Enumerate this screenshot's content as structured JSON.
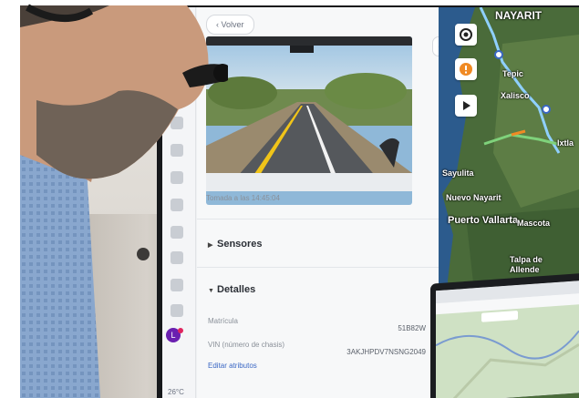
{
  "app": {
    "back_label": "Volver",
    "dashcam": {
      "caption": "Tomada a las 14:45:04"
    },
    "sections": {
      "sensores": "Sensores",
      "detalles": "Detalles"
    },
    "details": {
      "matricula_label": "Matrícula",
      "matricula_value": "51B82W",
      "vin_label": "VIN (número de chasis)",
      "vin_value": "3AKJHPDV7NSNG2049",
      "edit_link": "Editar atributos"
    },
    "rail": {
      "avatar_initial": "L",
      "temperature": "26°C"
    }
  },
  "map": {
    "labels": {
      "nayarit": "NAYARIT",
      "tepic": "Tepic",
      "xalisco": "Xalisco",
      "ixtlan": "Ixtla",
      "sayulita": "Sayulita",
      "nuevo_nayarit": "Nuevo Nayarit",
      "puerto_vallarta": "Puerto Vallarta",
      "mascota": "Mascota",
      "talpa": "Talpa de Allende"
    },
    "buttons": [
      "location-icon",
      "alert-icon",
      "play-icon"
    ]
  },
  "colors": {
    "accent": "#3a67c4",
    "route": "#8fd0ff",
    "alert": "#f08a24"
  }
}
